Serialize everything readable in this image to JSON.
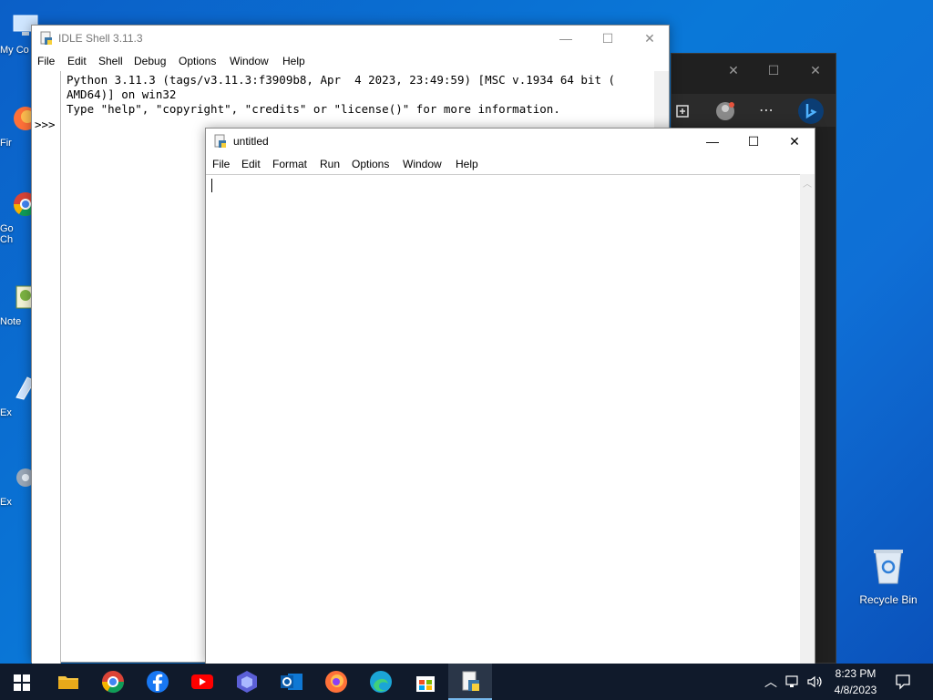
{
  "desktop": {
    "icons": [
      {
        "label": "My Co",
        "icon": "computer-icon"
      },
      {
        "label": "Fir",
        "icon": "firefox-shortcut-icon"
      },
      {
        "label": "Go\nCh",
        "icon": "chrome-shortcut-icon"
      },
      {
        "label": "Note",
        "icon": "notepad-shortcut-icon"
      },
      {
        "label": "Ex",
        "icon": "explorer-shortcut-icon"
      },
      {
        "label": "Ex",
        "icon": "settings-shortcut-icon"
      }
    ],
    "recycle_bin": {
      "label": "Recycle Bin",
      "icon": "recycle-bin-icon"
    }
  },
  "shell_window": {
    "title": "IDLE Shell 3.11.3",
    "menu": [
      "File",
      "Edit",
      "Shell",
      "Debug",
      "Options",
      "Window",
      "Help"
    ],
    "lines": [
      "Python 3.11.3 (tags/v3.11.3:f3909b8, Apr  4 2023, 23:49:59) [MSC v.1934 64 bit (",
      "AMD64)] on win32",
      "Type \"help\", \"copyright\", \"credits\" or \"license()\" for more information."
    ],
    "prompt": ">>>"
  },
  "editor_window": {
    "title": "untitled",
    "menu": [
      "File",
      "Edit",
      "Format",
      "Run",
      "Options",
      "Window",
      "Help"
    ],
    "content": ""
  },
  "taskbar": {
    "apps": [
      "start",
      "file-explorer",
      "chrome",
      "facebook",
      "youtube",
      "app-shield",
      "outlook",
      "firefox",
      "edge",
      "store",
      "idle"
    ],
    "time": "8:23 PM",
    "date": "4/8/2023"
  },
  "colors": {
    "desktop": "#0a78d8",
    "taskbar": "#101a2b",
    "accent": "#76b9ed"
  }
}
